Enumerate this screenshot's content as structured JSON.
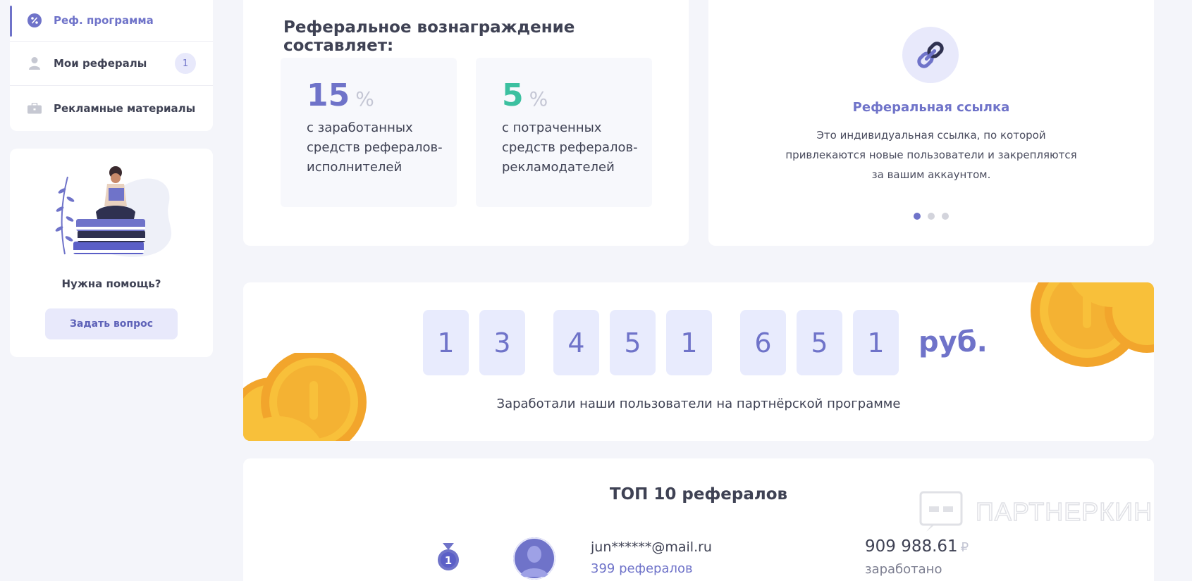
{
  "sidebar": {
    "items": [
      {
        "label": "Реф. программа"
      },
      {
        "label": "Мои рефералы",
        "badge": "1"
      },
      {
        "label": "Рекламные материалы"
      }
    ],
    "help": {
      "text": "Нужна помощь?",
      "button_label": "Задать вопрос"
    }
  },
  "reward": {
    "title": "Реферальное вознаграждение составляет:",
    "rates": [
      {
        "value": "15",
        "unit": "%",
        "desc": "с заработанных средств рефералов-исполнителей",
        "color": "#6f73c9"
      },
      {
        "value": "5",
        "unit": "%",
        "desc": "с потраченных средств рефералов-рекламодателей",
        "color": "#3cc0a0"
      }
    ]
  },
  "link_card": {
    "title": "Реферальная ссылка",
    "description": "Это индивидуальная ссылка, по которой привлекаются новые пользователи и закрепляются за вашим аккаунтом.",
    "slides_total": 3,
    "active_slide": 1
  },
  "counter": {
    "digits": [
      "1",
      "3",
      "4",
      "5",
      "1",
      "6",
      "5",
      "1"
    ],
    "currency": "руб.",
    "caption": "Заработали наши пользователи на партнёрской программе"
  },
  "top": {
    "title": "ТОП 10 рефералов",
    "rows": [
      {
        "rank": "1",
        "email": "jun******@mail.ru",
        "referrals": "399 рефералов",
        "amount": "909 988.61",
        "currency_symbol": "₽",
        "earned_label": "заработано"
      }
    ]
  },
  "watermark": {
    "text": "ПАРТНЕРКИН"
  },
  "colors": {
    "accent": "#6f73c9",
    "green": "#3cc0a0",
    "digit_bg": "#e8ebfd",
    "coin": "#f8c03a"
  }
}
